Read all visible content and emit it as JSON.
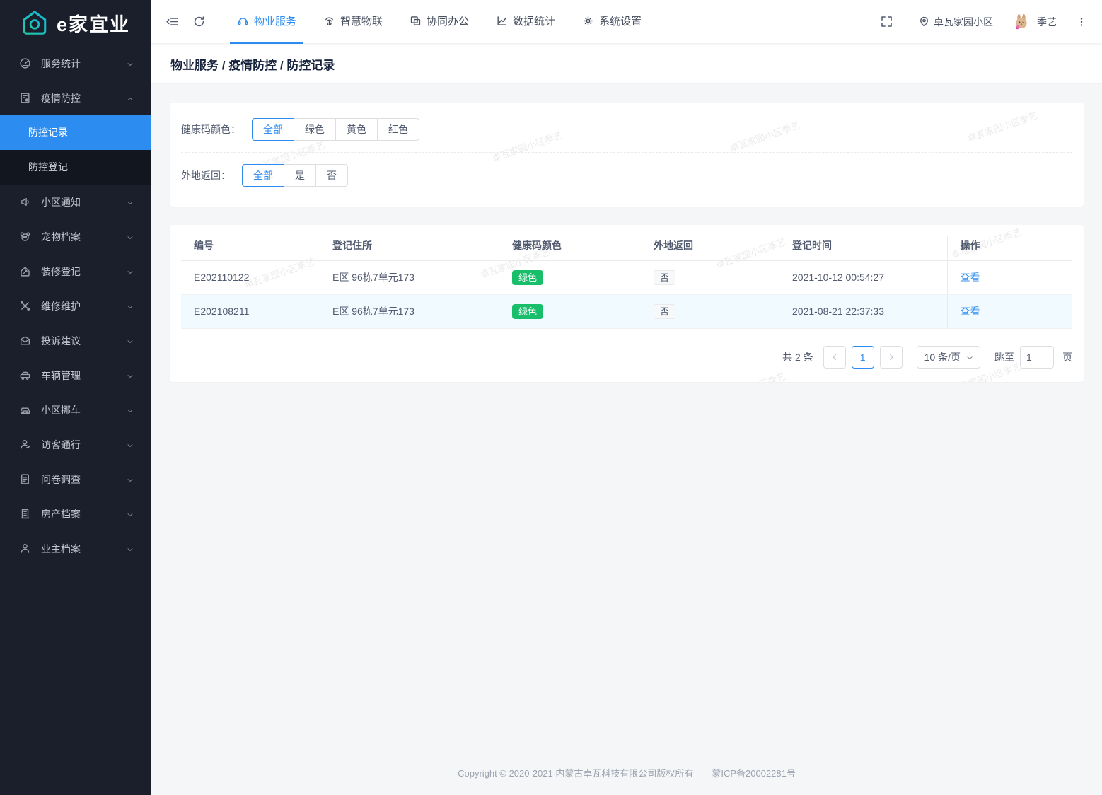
{
  "app": {
    "logo_text": "e家宜业"
  },
  "sidebar": {
    "items": [
      {
        "key": "service-stats",
        "label": "服务统计",
        "icon": "dashboard"
      },
      {
        "key": "epidemic-control",
        "label": "疫情防控",
        "icon": "epidemic",
        "expanded": true,
        "children": [
          {
            "key": "control-records",
            "label": "防控记录",
            "active": true
          },
          {
            "key": "control-register",
            "label": "防控登记",
            "active": false
          }
        ]
      },
      {
        "key": "community-notice",
        "label": "小区通知",
        "icon": "megaphone"
      },
      {
        "key": "pet-files",
        "label": "宠物档案",
        "icon": "pet"
      },
      {
        "key": "renovation-register",
        "label": "装修登记",
        "icon": "renovation"
      },
      {
        "key": "repair-maintenance",
        "label": "维修维护",
        "icon": "repair"
      },
      {
        "key": "complaints-suggestions",
        "label": "投诉建议",
        "icon": "complaint"
      },
      {
        "key": "vehicle-management",
        "label": "车辆管理",
        "icon": "vehicle"
      },
      {
        "key": "community-move-car",
        "label": "小区挪车",
        "icon": "movecar"
      },
      {
        "key": "visitor-access",
        "label": "访客通行",
        "icon": "visitor"
      },
      {
        "key": "questionnaire",
        "label": "问卷调查",
        "icon": "survey"
      },
      {
        "key": "property-files",
        "label": "房产档案",
        "icon": "building"
      },
      {
        "key": "owner-files",
        "label": "业主档案",
        "icon": "owner"
      }
    ]
  },
  "header": {
    "tabs": [
      {
        "key": "property-service",
        "label": "物业服务",
        "icon": "headset",
        "active": true
      },
      {
        "key": "smart-iot",
        "label": "智慧物联",
        "icon": "fingerprint",
        "active": false
      },
      {
        "key": "collaborative-office",
        "label": "协同办公",
        "icon": "office",
        "active": false
      },
      {
        "key": "data-statistics",
        "label": "数据统计",
        "icon": "stats",
        "active": false
      },
      {
        "key": "system-settings",
        "label": "系统设置",
        "icon": "gear",
        "active": false
      }
    ],
    "community": "卓瓦家园小区",
    "username": "季艺"
  },
  "breadcrumb": "物业服务 / 疫情防控 / 防控记录",
  "filters": {
    "health_label": "健康码颜色：",
    "health_options": [
      "全部",
      "绿色",
      "黄色",
      "红色"
    ],
    "health_selected": "全部",
    "return_label": "外地返回：",
    "return_options": [
      "全部",
      "是",
      "否"
    ],
    "return_selected": "全部"
  },
  "table": {
    "columns": [
      "编号",
      "登记住所",
      "健康码颜色",
      "外地返回",
      "登记时间",
      "操作"
    ],
    "rows": [
      {
        "id": "E202110122",
        "address": "E区 96栋7单元173",
        "health_code": "绿色",
        "returned": "否",
        "time": "2021-10-12 00:54:27",
        "action": "查看"
      },
      {
        "id": "E202108211",
        "address": "E区 96栋7单元173",
        "health_code": "绿色",
        "returned": "否",
        "time": "2021-08-21 22:37:33",
        "action": "查看"
      }
    ]
  },
  "pagination": {
    "total": "共 2 条",
    "current_page": "1",
    "page_size": "10 条/页",
    "jump_label": "跳至",
    "jump_value": "1",
    "jump_suffix": "页"
  },
  "footer": {
    "copyright": "Copyright © 2020-2021 内蒙古卓瓦科技有限公司版权所有",
    "icp": "蒙ICP备20002281号"
  },
  "watermark": {
    "text": "卓瓦家园小区季艺"
  },
  "colors": {
    "primary": "#2d8cf0",
    "success": "#19be6b",
    "sidebar_bg": "#1a1f2b",
    "submenu_bg": "#12161f",
    "content_bg": "#f5f6f8"
  }
}
